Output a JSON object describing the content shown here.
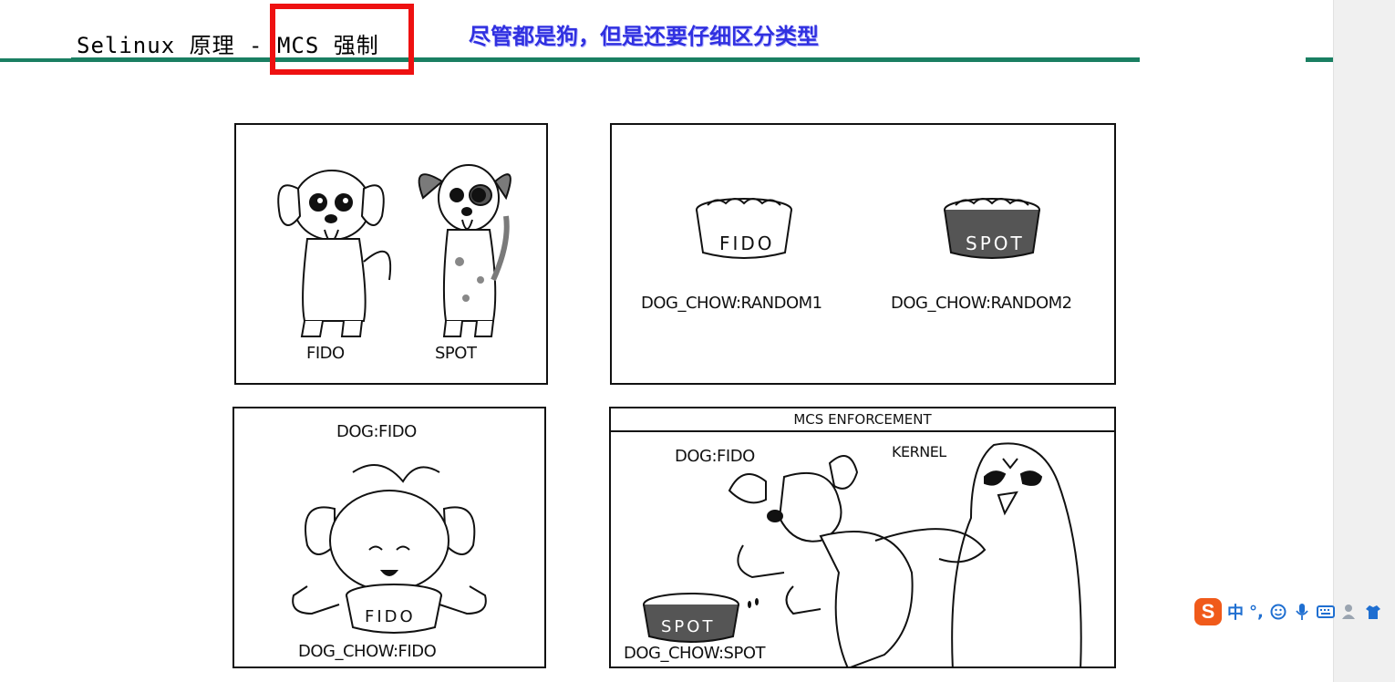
{
  "slide": {
    "title": "Selinux 原理 - MCS 强制",
    "annotation": "尽管都是狗，但是还要仔细区分类型",
    "accent_color": "#1a7f62",
    "highlight_color": "#ee1111",
    "annotation_color": "#3030e0"
  },
  "panels": {
    "dogs": {
      "label_left": "FIDO",
      "label_right": "SPOT"
    },
    "bowls": {
      "bowl_left_text": "FIDO",
      "bowl_right_text": "SPOT",
      "label_left": "DOG_CHOW:RANDOM1",
      "label_right": "DOG_CHOW:RANDOM2"
    },
    "eating": {
      "top_label": "DOG:FIDO",
      "bowl_text": "FIDO",
      "bottom_label": "DOG_CHOW:FIDO"
    },
    "enforcement": {
      "caption": "MCS ENFORCEMENT",
      "dog_label": "DOG:FIDO",
      "kernel_label": "KERNEL",
      "bowl_text": "SPOT",
      "bottom_label": "DOG_CHOW:SPOT"
    }
  },
  "ime_toolbar": {
    "logo": "S",
    "mode": "中",
    "punct": "°,",
    "icons": [
      "emoji-icon",
      "microphone-icon",
      "keyboard-icon",
      "user-icon",
      "shirt-icon"
    ]
  }
}
